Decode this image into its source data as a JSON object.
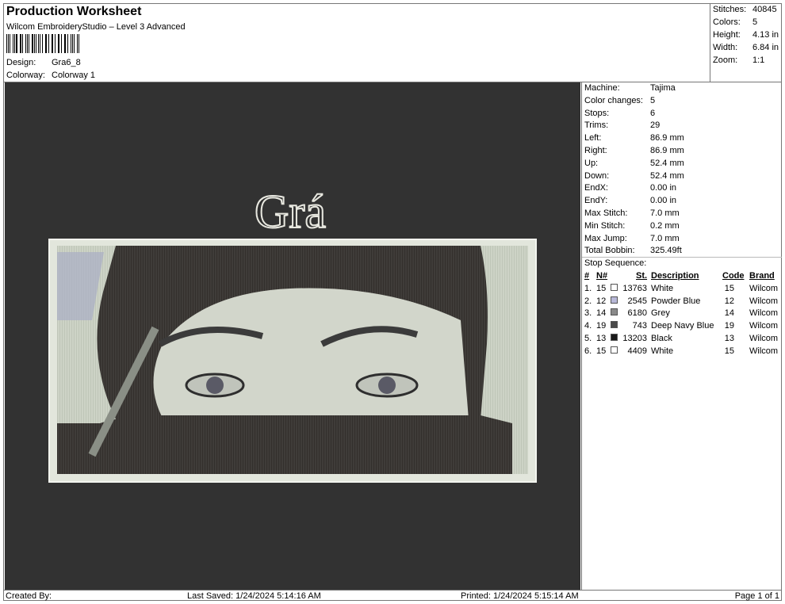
{
  "header": {
    "title": "Production Worksheet",
    "software": "Wilcom EmbroideryStudio – Level 3 Advanced",
    "design_label": "Design:",
    "design_value": "Gra6_8",
    "colorway_label": "Colorway:",
    "colorway_value": "Colorway 1"
  },
  "summary": {
    "stitches_label": "Stitches:",
    "stitches": "40845",
    "colors_label": "Colors:",
    "colors": "5",
    "height_label": "Height:",
    "height": "4.13 in",
    "width_label": "Width:",
    "width": "6.84 in",
    "zoom_label": "Zoom:",
    "zoom": "1:1"
  },
  "design": {
    "text": "Grá"
  },
  "machine_info": [
    {
      "label": "Machine:",
      "value": "Tajima"
    },
    {
      "label": "Color changes:",
      "value": "5"
    },
    {
      "label": "Stops:",
      "value": "6"
    },
    {
      "label": "Trims:",
      "value": "29"
    },
    {
      "label": "Left:",
      "value": "86.9 mm"
    },
    {
      "label": "Right:",
      "value": "86.9 mm"
    },
    {
      "label": "Up:",
      "value": "52.4 mm"
    },
    {
      "label": "Down:",
      "value": "52.4 mm"
    },
    {
      "label": "EndX:",
      "value": "0.00 in"
    },
    {
      "label": "EndY:",
      "value": "0.00 in"
    },
    {
      "label": "Max Stitch:",
      "value": "7.0 mm"
    },
    {
      "label": "Min Stitch:",
      "value": "0.2 mm"
    },
    {
      "label": "Max Jump:",
      "value": "7.0 mm"
    },
    {
      "label": "Total Bobbin:",
      "value": "325.49ft"
    }
  ],
  "stop_sequence": {
    "label": "Stop Sequence:",
    "headers": {
      "num": "#",
      "n": "N#",
      "st": "St.",
      "desc": "Description",
      "code": "Code",
      "brand": "Brand"
    },
    "rows": [
      {
        "num": "1.",
        "n": "15",
        "color": "#ffffff",
        "st": "13763",
        "desc": "White",
        "code": "15",
        "brand": "Wilcom"
      },
      {
        "num": "2.",
        "n": "12",
        "color": "#b8b8d8",
        "st": "2545",
        "desc": "Powder Blue",
        "code": "12",
        "brand": "Wilcom"
      },
      {
        "num": "3.",
        "n": "14",
        "color": "#8a8a8a",
        "st": "6180",
        "desc": "Grey",
        "code": "14",
        "brand": "Wilcom"
      },
      {
        "num": "4.",
        "n": "19",
        "color": "#4a4a4a",
        "st": "743",
        "desc": "Deep Navy Blue",
        "code": "19",
        "brand": "Wilcom"
      },
      {
        "num": "5.",
        "n": "13",
        "color": "#1a1a1a",
        "st": "13203",
        "desc": "Black",
        "code": "13",
        "brand": "Wilcom"
      },
      {
        "num": "6.",
        "n": "15",
        "color": "#ffffff",
        "st": "4409",
        "desc": "White",
        "code": "15",
        "brand": "Wilcom"
      }
    ]
  },
  "footer": {
    "created_by": "Created By:",
    "last_saved": "Last Saved: 1/24/2024 5:14:16 AM",
    "printed": "Printed: 1/24/2024 5:15:14 AM",
    "page": "Page 1 of 1"
  }
}
